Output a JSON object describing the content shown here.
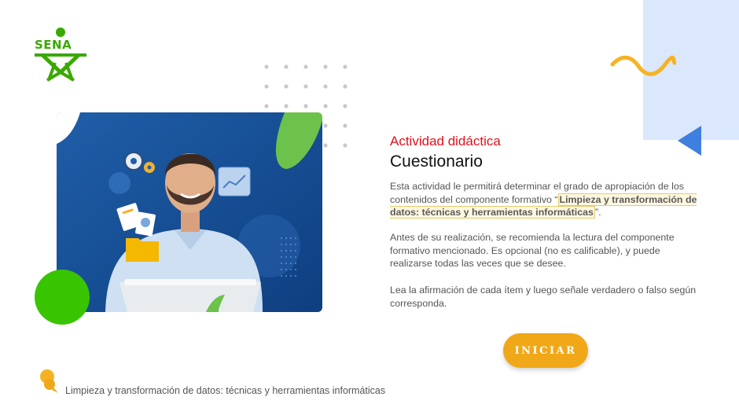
{
  "logo": {
    "text": "SENA"
  },
  "activity": {
    "label": "Actividad didáctica",
    "title": "Cuestionario",
    "p1_before": "Esta actividad le permitirá determinar el grado de apropiación de los contenidos del componente formativo “",
    "p1_highlight": "Limpieza y transformación de datos: técnicas y herramientas informáticas",
    "p1_after": "”.",
    "p2": "Antes de su realización, se recomienda la lectura del componente formativo mencionado.  Es opcional (no es calificable), y puede realizarse todas las veces que se desee.",
    "p3": "Lea la afirmación de cada ítem y luego señale verdadero o falso según corresponda."
  },
  "start_button": {
    "label": "INICIAR"
  },
  "footer": {
    "text": "Limpieza y transformación de datos: técnicas y herramientas informáticas"
  },
  "colors": {
    "accent_red": "#e2101a",
    "brand_green": "#39a900",
    "button_orange": "#f0a818",
    "decor_blue": "#3f7fe0",
    "decor_lightblue": "#dbe7fb",
    "decor_yellow": "#f5b324"
  },
  "icons": [
    "sena-logo",
    "wave-decoration",
    "triangle-decoration",
    "dot-grid-decoration",
    "footer-chat-icon"
  ]
}
